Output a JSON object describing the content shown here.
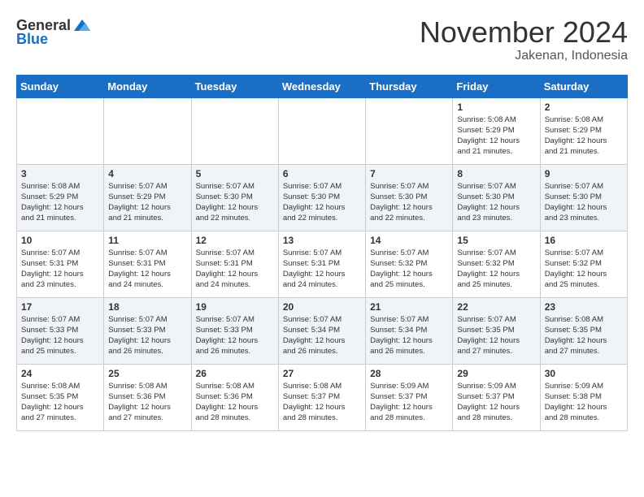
{
  "logo": {
    "general": "General",
    "blue": "Blue"
  },
  "header": {
    "month": "November 2024",
    "location": "Jakenan, Indonesia"
  },
  "weekdays": [
    "Sunday",
    "Monday",
    "Tuesday",
    "Wednesday",
    "Thursday",
    "Friday",
    "Saturday"
  ],
  "weeks": [
    [
      {
        "day": "",
        "info": ""
      },
      {
        "day": "",
        "info": ""
      },
      {
        "day": "",
        "info": ""
      },
      {
        "day": "",
        "info": ""
      },
      {
        "day": "",
        "info": ""
      },
      {
        "day": "1",
        "info": "Sunrise: 5:08 AM\nSunset: 5:29 PM\nDaylight: 12 hours\nand 21 minutes."
      },
      {
        "day": "2",
        "info": "Sunrise: 5:08 AM\nSunset: 5:29 PM\nDaylight: 12 hours\nand 21 minutes."
      }
    ],
    [
      {
        "day": "3",
        "info": "Sunrise: 5:08 AM\nSunset: 5:29 PM\nDaylight: 12 hours\nand 21 minutes."
      },
      {
        "day": "4",
        "info": "Sunrise: 5:07 AM\nSunset: 5:29 PM\nDaylight: 12 hours\nand 21 minutes."
      },
      {
        "day": "5",
        "info": "Sunrise: 5:07 AM\nSunset: 5:30 PM\nDaylight: 12 hours\nand 22 minutes."
      },
      {
        "day": "6",
        "info": "Sunrise: 5:07 AM\nSunset: 5:30 PM\nDaylight: 12 hours\nand 22 minutes."
      },
      {
        "day": "7",
        "info": "Sunrise: 5:07 AM\nSunset: 5:30 PM\nDaylight: 12 hours\nand 22 minutes."
      },
      {
        "day": "8",
        "info": "Sunrise: 5:07 AM\nSunset: 5:30 PM\nDaylight: 12 hours\nand 23 minutes."
      },
      {
        "day": "9",
        "info": "Sunrise: 5:07 AM\nSunset: 5:30 PM\nDaylight: 12 hours\nand 23 minutes."
      }
    ],
    [
      {
        "day": "10",
        "info": "Sunrise: 5:07 AM\nSunset: 5:31 PM\nDaylight: 12 hours\nand 23 minutes."
      },
      {
        "day": "11",
        "info": "Sunrise: 5:07 AM\nSunset: 5:31 PM\nDaylight: 12 hours\nand 24 minutes."
      },
      {
        "day": "12",
        "info": "Sunrise: 5:07 AM\nSunset: 5:31 PM\nDaylight: 12 hours\nand 24 minutes."
      },
      {
        "day": "13",
        "info": "Sunrise: 5:07 AM\nSunset: 5:31 PM\nDaylight: 12 hours\nand 24 minutes."
      },
      {
        "day": "14",
        "info": "Sunrise: 5:07 AM\nSunset: 5:32 PM\nDaylight: 12 hours\nand 25 minutes."
      },
      {
        "day": "15",
        "info": "Sunrise: 5:07 AM\nSunset: 5:32 PM\nDaylight: 12 hours\nand 25 minutes."
      },
      {
        "day": "16",
        "info": "Sunrise: 5:07 AM\nSunset: 5:32 PM\nDaylight: 12 hours\nand 25 minutes."
      }
    ],
    [
      {
        "day": "17",
        "info": "Sunrise: 5:07 AM\nSunset: 5:33 PM\nDaylight: 12 hours\nand 25 minutes."
      },
      {
        "day": "18",
        "info": "Sunrise: 5:07 AM\nSunset: 5:33 PM\nDaylight: 12 hours\nand 26 minutes."
      },
      {
        "day": "19",
        "info": "Sunrise: 5:07 AM\nSunset: 5:33 PM\nDaylight: 12 hours\nand 26 minutes."
      },
      {
        "day": "20",
        "info": "Sunrise: 5:07 AM\nSunset: 5:34 PM\nDaylight: 12 hours\nand 26 minutes."
      },
      {
        "day": "21",
        "info": "Sunrise: 5:07 AM\nSunset: 5:34 PM\nDaylight: 12 hours\nand 26 minutes."
      },
      {
        "day": "22",
        "info": "Sunrise: 5:07 AM\nSunset: 5:35 PM\nDaylight: 12 hours\nand 27 minutes."
      },
      {
        "day": "23",
        "info": "Sunrise: 5:08 AM\nSunset: 5:35 PM\nDaylight: 12 hours\nand 27 minutes."
      }
    ],
    [
      {
        "day": "24",
        "info": "Sunrise: 5:08 AM\nSunset: 5:35 PM\nDaylight: 12 hours\nand 27 minutes."
      },
      {
        "day": "25",
        "info": "Sunrise: 5:08 AM\nSunset: 5:36 PM\nDaylight: 12 hours\nand 27 minutes."
      },
      {
        "day": "26",
        "info": "Sunrise: 5:08 AM\nSunset: 5:36 PM\nDaylight: 12 hours\nand 28 minutes."
      },
      {
        "day": "27",
        "info": "Sunrise: 5:08 AM\nSunset: 5:37 PM\nDaylight: 12 hours\nand 28 minutes."
      },
      {
        "day": "28",
        "info": "Sunrise: 5:09 AM\nSunset: 5:37 PM\nDaylight: 12 hours\nand 28 minutes."
      },
      {
        "day": "29",
        "info": "Sunrise: 5:09 AM\nSunset: 5:37 PM\nDaylight: 12 hours\nand 28 minutes."
      },
      {
        "day": "30",
        "info": "Sunrise: 5:09 AM\nSunset: 5:38 PM\nDaylight: 12 hours\nand 28 minutes."
      }
    ]
  ]
}
